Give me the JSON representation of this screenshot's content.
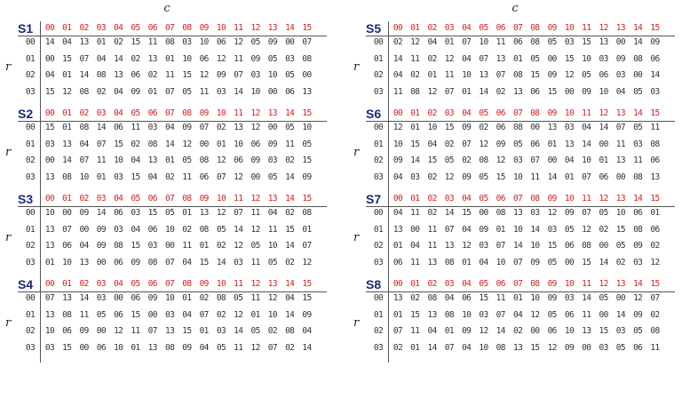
{
  "axis": {
    "column_symbol": "c",
    "row_symbol": "r"
  },
  "columns": [
    "00",
    "01",
    "02",
    "03",
    "04",
    "05",
    "06",
    "07",
    "08",
    "09",
    "10",
    "11",
    "12",
    "13",
    "14",
    "15"
  ],
  "rows": [
    "00",
    "01",
    "02",
    "03"
  ],
  "sboxes": [
    {
      "name": "S1",
      "data": [
        [
          "14",
          "04",
          "13",
          "01",
          "02",
          "15",
          "11",
          "08",
          "03",
          "10",
          "06",
          "12",
          "05",
          "09",
          "00",
          "07"
        ],
        [
          "00",
          "15",
          "07",
          "04",
          "14",
          "02",
          "13",
          "01",
          "10",
          "06",
          "12",
          "11",
          "09",
          "05",
          "03",
          "08"
        ],
        [
          "04",
          "01",
          "14",
          "08",
          "13",
          "06",
          "02",
          "11",
          "15",
          "12",
          "09",
          "07",
          "03",
          "10",
          "05",
          "00"
        ],
        [
          "15",
          "12",
          "08",
          "02",
          "04",
          "09",
          "01",
          "07",
          "05",
          "11",
          "03",
          "14",
          "10",
          "00",
          "06",
          "13"
        ]
      ]
    },
    {
      "name": "S2",
      "data": [
        [
          "15",
          "01",
          "08",
          "14",
          "06",
          "11",
          "03",
          "04",
          "09",
          "07",
          "02",
          "13",
          "12",
          "00",
          "05",
          "10"
        ],
        [
          "03",
          "13",
          "04",
          "07",
          "15",
          "02",
          "08",
          "14",
          "12",
          "00",
          "01",
          "10",
          "06",
          "09",
          "11",
          "05"
        ],
        [
          "00",
          "14",
          "07",
          "11",
          "10",
          "04",
          "13",
          "01",
          "05",
          "08",
          "12",
          "06",
          "09",
          "03",
          "02",
          "15"
        ],
        [
          "13",
          "08",
          "10",
          "01",
          "03",
          "15",
          "04",
          "02",
          "11",
          "06",
          "07",
          "12",
          "00",
          "05",
          "14",
          "09"
        ]
      ]
    },
    {
      "name": "S3",
      "data": [
        [
          "10",
          "00",
          "09",
          "14",
          "06",
          "03",
          "15",
          "05",
          "01",
          "13",
          "12",
          "07",
          "11",
          "04",
          "02",
          "08"
        ],
        [
          "13",
          "07",
          "00",
          "09",
          "03",
          "04",
          "06",
          "10",
          "02",
          "08",
          "05",
          "14",
          "12",
          "11",
          "15",
          "01"
        ],
        [
          "13",
          "06",
          "04",
          "09",
          "08",
          "15",
          "03",
          "00",
          "11",
          "01",
          "02",
          "12",
          "05",
          "10",
          "14",
          "07"
        ],
        [
          "01",
          "10",
          "13",
          "00",
          "06",
          "09",
          "08",
          "07",
          "04",
          "15",
          "14",
          "03",
          "11",
          "05",
          "02",
          "12"
        ]
      ]
    },
    {
      "name": "S4",
      "data": [
        [
          "07",
          "13",
          "14",
          "03",
          "00",
          "06",
          "09",
          "10",
          "01",
          "02",
          "08",
          "05",
          "11",
          "12",
          "04",
          "15"
        ],
        [
          "13",
          "08",
          "11",
          "05",
          "06",
          "15",
          "00",
          "03",
          "04",
          "07",
          "02",
          "12",
          "01",
          "10",
          "14",
          "09"
        ],
        [
          "10",
          "06",
          "09",
          "00",
          "12",
          "11",
          "07",
          "13",
          "15",
          "01",
          "03",
          "14",
          "05",
          "02",
          "08",
          "04"
        ],
        [
          "03",
          "15",
          "00",
          "06",
          "10",
          "01",
          "13",
          "08",
          "09",
          "04",
          "05",
          "11",
          "12",
          "07",
          "02",
          "14"
        ]
      ]
    },
    {
      "name": "S5",
      "data": [
        [
          "02",
          "12",
          "04",
          "01",
          "07",
          "10",
          "11",
          "06",
          "08",
          "05",
          "03",
          "15",
          "13",
          "00",
          "14",
          "09"
        ],
        [
          "14",
          "11",
          "02",
          "12",
          "04",
          "07",
          "13",
          "01",
          "05",
          "00",
          "15",
          "10",
          "03",
          "09",
          "08",
          "06"
        ],
        [
          "04",
          "02",
          "01",
          "11",
          "10",
          "13",
          "07",
          "08",
          "15",
          "09",
          "12",
          "05",
          "06",
          "03",
          "00",
          "14"
        ],
        [
          "11",
          "08",
          "12",
          "07",
          "01",
          "14",
          "02",
          "13",
          "06",
          "15",
          "00",
          "09",
          "10",
          "04",
          "05",
          "03"
        ]
      ]
    },
    {
      "name": "S6",
      "data": [
        [
          "12",
          "01",
          "10",
          "15",
          "09",
          "02",
          "06",
          "08",
          "00",
          "13",
          "03",
          "04",
          "14",
          "07",
          "05",
          "11"
        ],
        [
          "10",
          "15",
          "04",
          "02",
          "07",
          "12",
          "09",
          "05",
          "06",
          "01",
          "13",
          "14",
          "00",
          "11",
          "03",
          "08"
        ],
        [
          "09",
          "14",
          "15",
          "05",
          "02",
          "08",
          "12",
          "03",
          "07",
          "00",
          "04",
          "10",
          "01",
          "13",
          "11",
          "06"
        ],
        [
          "04",
          "03",
          "02",
          "12",
          "09",
          "05",
          "15",
          "10",
          "11",
          "14",
          "01",
          "07",
          "06",
          "00",
          "08",
          "13"
        ]
      ]
    },
    {
      "name": "S7",
      "data": [
        [
          "04",
          "11",
          "02",
          "14",
          "15",
          "00",
          "08",
          "13",
          "03",
          "12",
          "09",
          "07",
          "05",
          "10",
          "06",
          "01"
        ],
        [
          "13",
          "00",
          "11",
          "07",
          "04",
          "09",
          "01",
          "10",
          "14",
          "03",
          "05",
          "12",
          "02",
          "15",
          "08",
          "06"
        ],
        [
          "01",
          "04",
          "11",
          "13",
          "12",
          "03",
          "07",
          "14",
          "10",
          "15",
          "06",
          "08",
          "00",
          "05",
          "09",
          "02"
        ],
        [
          "06",
          "11",
          "13",
          "08",
          "01",
          "04",
          "10",
          "07",
          "09",
          "05",
          "00",
          "15",
          "14",
          "02",
          "03",
          "12"
        ]
      ]
    },
    {
      "name": "S8",
      "data": [
        [
          "13",
          "02",
          "08",
          "04",
          "06",
          "15",
          "11",
          "01",
          "10",
          "09",
          "03",
          "14",
          "05",
          "00",
          "12",
          "07"
        ],
        [
          "01",
          "15",
          "13",
          "08",
          "10",
          "03",
          "07",
          "04",
          "12",
          "05",
          "06",
          "11",
          "00",
          "14",
          "09",
          "02"
        ],
        [
          "07",
          "11",
          "04",
          "01",
          "09",
          "12",
          "14",
          "02",
          "00",
          "06",
          "10",
          "13",
          "15",
          "03",
          "05",
          "08"
        ],
        [
          "02",
          "01",
          "14",
          "07",
          "04",
          "10",
          "08",
          "13",
          "15",
          "12",
          "09",
          "00",
          "03",
          "05",
          "06",
          "11"
        ]
      ]
    }
  ]
}
